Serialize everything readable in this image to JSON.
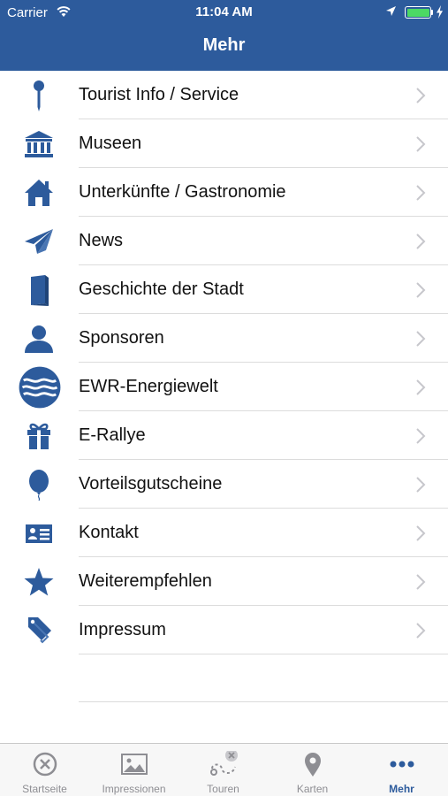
{
  "status": {
    "carrier": "Carrier",
    "time": "11:04 AM"
  },
  "nav": {
    "title": "Mehr"
  },
  "menu": [
    {
      "label": "Tourist Info / Service",
      "icon": "map-pin-icon"
    },
    {
      "label": "Museen",
      "icon": "museum-icon"
    },
    {
      "label": "Unterkünfte / Gastronomie",
      "icon": "house-icon"
    },
    {
      "label": "News",
      "icon": "paper-plane-icon"
    },
    {
      "label": "Geschichte der Stadt",
      "icon": "book-icon"
    },
    {
      "label": "Sponsoren",
      "icon": "person-icon"
    },
    {
      "label": "EWR-Energiewelt",
      "icon": "ewr-waves-logo-icon"
    },
    {
      "label": "E-Rallye",
      "icon": "gift-icon"
    },
    {
      "label": "Vorteilsgutscheine",
      "icon": "balloon-icon"
    },
    {
      "label": "Kontakt",
      "icon": "contact-card-icon"
    },
    {
      "label": "Weiterempfehlen",
      "icon": "star-icon"
    },
    {
      "label": "Impressum",
      "icon": "tags-icon"
    }
  ],
  "tabs": [
    {
      "label": "Startseite",
      "icon": "close-circle-icon",
      "active": false
    },
    {
      "label": "Impressionen",
      "icon": "image-icon",
      "active": false
    },
    {
      "label": "Touren",
      "icon": "route-icon",
      "active": false
    },
    {
      "label": "Karten",
      "icon": "map-marker-icon",
      "active": false
    },
    {
      "label": "Mehr",
      "icon": "more-dots-icon",
      "active": true
    }
  ],
  "colors": {
    "brand": "#2d5b9c",
    "icon": "#2d5b9c",
    "tab_inactive": "#8e8e93",
    "battery": "#4cd964"
  }
}
